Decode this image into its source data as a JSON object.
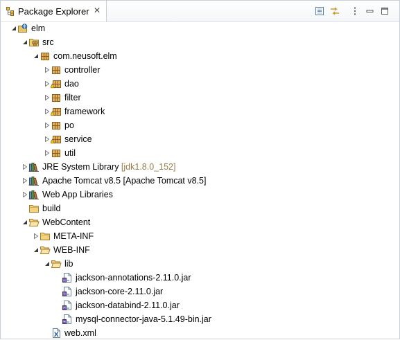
{
  "view": {
    "title": "Package Explorer"
  },
  "toolbar": {
    "icons": [
      "collapse-all-icon",
      "link-with-editor-icon",
      "view-menu-icon",
      "minimize-icon",
      "maximize-icon"
    ]
  },
  "tree": [
    {
      "label": "elm",
      "decoration": "",
      "icon": "project",
      "indent": 0,
      "toggle": "expanded"
    },
    {
      "label": "src",
      "decoration": "",
      "icon": "srcfolder",
      "indent": 1,
      "toggle": "expanded"
    },
    {
      "label": "com.neusoft.elm",
      "decoration": "",
      "icon": "package",
      "indent": 2,
      "toggle": "expanded"
    },
    {
      "label": "controller",
      "decoration": "",
      "icon": "package",
      "indent": 3,
      "toggle": "collapsed"
    },
    {
      "label": "dao",
      "decoration": "",
      "icon": "package-warn",
      "indent": 3,
      "toggle": "collapsed"
    },
    {
      "label": "filter",
      "decoration": "",
      "icon": "package",
      "indent": 3,
      "toggle": "collapsed"
    },
    {
      "label": "framework",
      "decoration": "",
      "icon": "package-warn",
      "indent": 3,
      "toggle": "collapsed"
    },
    {
      "label": "po",
      "decoration": "",
      "icon": "package",
      "indent": 3,
      "toggle": "collapsed"
    },
    {
      "label": "service",
      "decoration": "",
      "icon": "package-warn",
      "indent": 3,
      "toggle": "collapsed"
    },
    {
      "label": "util",
      "decoration": "",
      "icon": "package",
      "indent": 3,
      "toggle": "collapsed"
    },
    {
      "label": "JRE System Library",
      "decoration": " [jdk1.8.0_152]",
      "icon": "library",
      "indent": 1,
      "toggle": "collapsed"
    },
    {
      "label": "Apache Tomcat v8.5 [Apache Tomcat v8.5]",
      "decoration": "",
      "icon": "library",
      "indent": 1,
      "toggle": "collapsed"
    },
    {
      "label": "Web App Libraries",
      "decoration": "",
      "icon": "library",
      "indent": 1,
      "toggle": "collapsed"
    },
    {
      "label": "build",
      "decoration": "",
      "icon": "folder",
      "indent": 1,
      "toggle": "none"
    },
    {
      "label": "WebContent",
      "decoration": "",
      "icon": "folder-open",
      "indent": 1,
      "toggle": "expanded"
    },
    {
      "label": "META-INF",
      "decoration": "",
      "icon": "folder",
      "indent": 2,
      "toggle": "collapsed"
    },
    {
      "label": "WEB-INF",
      "decoration": "",
      "icon": "folder-open",
      "indent": 2,
      "toggle": "expanded"
    },
    {
      "label": "lib",
      "decoration": "",
      "icon": "folder-open",
      "indent": 3,
      "toggle": "expanded"
    },
    {
      "label": "jackson-annotations-2.11.0.jar",
      "decoration": "",
      "icon": "jar",
      "indent": 4,
      "toggle": "none"
    },
    {
      "label": "jackson-core-2.11.0.jar",
      "decoration": "",
      "icon": "jar",
      "indent": 4,
      "toggle": "none"
    },
    {
      "label": "jackson-databind-2.11.0.jar",
      "decoration": "",
      "icon": "jar",
      "indent": 4,
      "toggle": "none"
    },
    {
      "label": "mysql-connector-java-5.1.49-bin.jar",
      "decoration": "",
      "icon": "jar",
      "indent": 4,
      "toggle": "none"
    },
    {
      "label": "web.xml",
      "decoration": "",
      "icon": "xml",
      "indent": 3,
      "toggle": "none"
    }
  ]
}
